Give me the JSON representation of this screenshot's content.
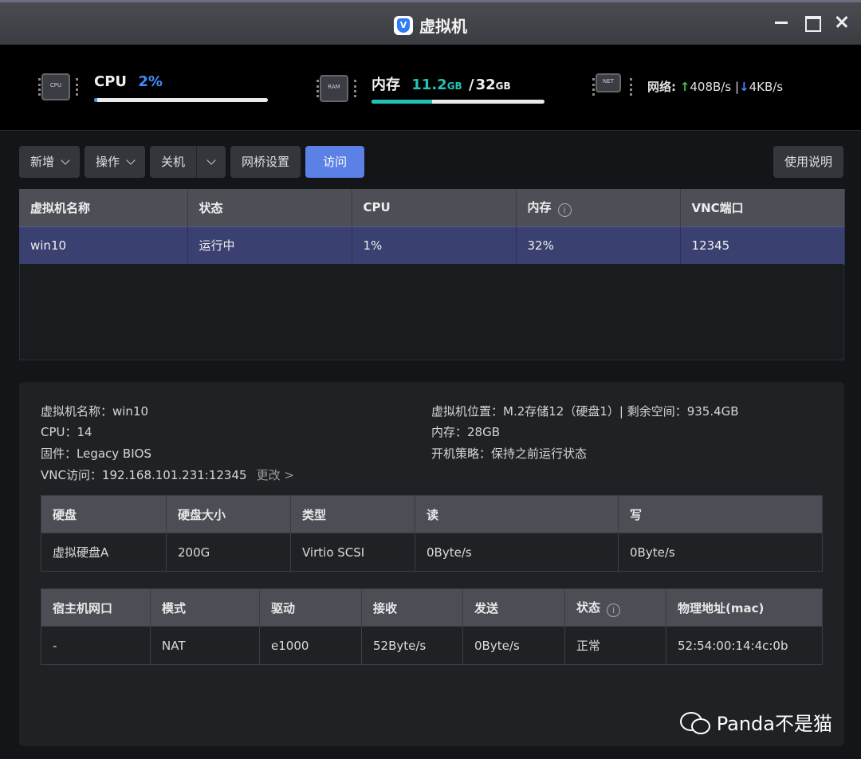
{
  "window": {
    "title": "虚拟机"
  },
  "stats": {
    "cpu": {
      "label": "CPU",
      "value": "2%",
      "chip_text": "CPU",
      "usage_fraction": 0.02,
      "color": "#3f8cff"
    },
    "mem": {
      "label": "内存",
      "used": "11.2",
      "used_unit": "GB",
      "sep": "/",
      "total": "32",
      "total_unit": "GB",
      "chip_text": "RAM",
      "usage_fraction": 0.35,
      "color": "#22c3b4"
    },
    "net": {
      "label": "网络:",
      "up": "408B/s",
      "sep": "|",
      "down": "4KB/s",
      "chip_text": "NET"
    }
  },
  "toolbar": {
    "add": "新增",
    "ops": "操作",
    "shutdown": "关机",
    "bridge": "网桥设置",
    "visit": "访问",
    "help": "使用说明"
  },
  "vm_table": {
    "headers": [
      "虚拟机名称",
      "状态",
      "CPU",
      "内存",
      "VNC端口"
    ],
    "rows": [
      [
        "win10",
        "运行中",
        "1%",
        "32%",
        "12345"
      ]
    ]
  },
  "detail": {
    "name": "虚拟机名称：win10",
    "cpu": "CPU：14",
    "firmware": "固件：Legacy BIOS",
    "vnc": "VNC访问：192.168.101.231:12345",
    "vnc_change": "更改 >",
    "location": "虚拟机位置：M.2存储12（硬盘1）| 剩余空间：935.4GB",
    "memory": "内存：28GB",
    "boot_policy": "开机策略：保持之前运行状态"
  },
  "disk_table": {
    "headers": [
      "硬盘",
      "硬盘大小",
      "类型",
      "读",
      "写"
    ],
    "rows": [
      [
        "虚拟硬盘A",
        "200G",
        "Virtio SCSI",
        "0Byte/s",
        "0Byte/s"
      ]
    ]
  },
  "net_table": {
    "headers": [
      "宿主机网口",
      "模式",
      "驱动",
      "接收",
      "发送",
      "状态",
      "物理地址(mac)"
    ],
    "rows": [
      [
        "-",
        "NAT",
        "e1000",
        "52Byte/s",
        "0Byte/s",
        "正常",
        "52:54:00:14:4c:0b"
      ]
    ]
  },
  "watermark": "Panda不是猫"
}
